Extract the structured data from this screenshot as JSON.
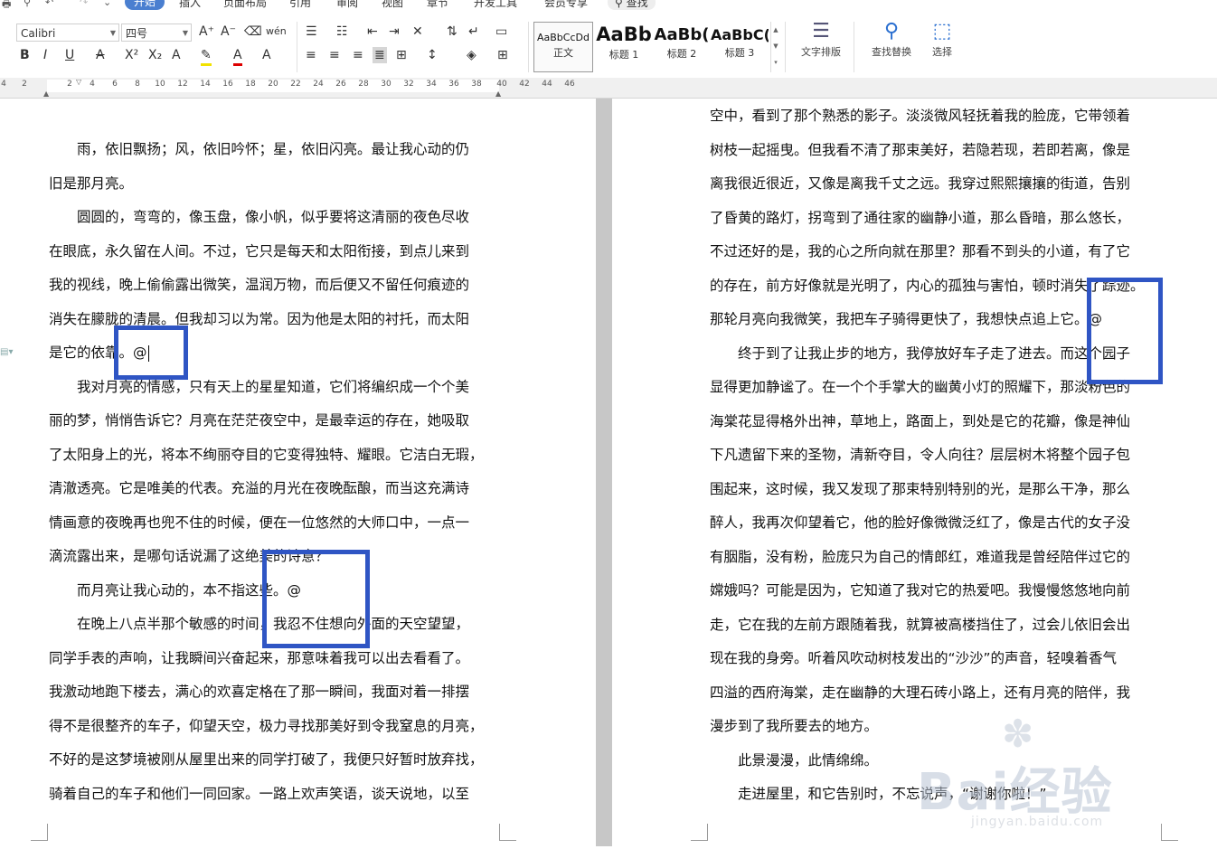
{
  "menu": {
    "tabs": [
      "开始",
      "插入",
      "页面布局",
      "引用",
      "审阅",
      "视图",
      "章节",
      "开发工具",
      "会员专享"
    ],
    "active_tab": "开始",
    "search_label": "查找"
  },
  "ribbon": {
    "font_family": "Calibri",
    "font_size": "四号",
    "styles": [
      {
        "sample": "AaBbCcDd",
        "name": "正文"
      },
      {
        "sample": "AaBb",
        "name": "标题 1"
      },
      {
        "sample": "AaBb(",
        "name": "标题 2"
      },
      {
        "sample": "AaBbC(",
        "name": "标题 3"
      }
    ],
    "text_layout_label": "文字排版",
    "find_replace_label": "查找替换",
    "select_label": "选择"
  },
  "ruler": {
    "ticks": [
      "4",
      "2",
      "2",
      "4",
      "6",
      "8",
      "10",
      "12",
      "14",
      "16",
      "18",
      "20",
      "22",
      "24",
      "26",
      "28",
      "30",
      "32",
      "34",
      "36",
      "38",
      "40",
      "42",
      "44",
      "46"
    ]
  },
  "left_page": {
    "lines": [
      "　　雨，依旧飘扬；风，依旧吟怀；星，依旧闪亮。最让我心动的仍",
      "旧是那月亮。",
      "　　圆圆的，弯弯的，像玉盘，像小帆，似乎要将这清丽的夜色尽收",
      "在眼底，永久留在人间。不过，它只是每天和太阳衔接，到点儿来到",
      "我的视线，晚上偷偷露出微笑，温润万物，而后便又不留任何痕迹的",
      "消失在朦胧的清晨。但我却习以为常。因为他是太阳的衬托，而太阳",
      "是它的依靠。@",
      "　　我对月亮的情感，只有天上的星星知道，它们将编织成一个个美",
      "丽的梦，悄悄告诉它？月亮在茫茫夜空中，是最幸运的存在，她吸取",
      "了太阳身上的光，将本不绚丽夺目的它变得独特、耀眼。它洁白无瑕，",
      "清澈透亮。它是唯美的代表。充溢的月光在夜晚酝酿，而当这充满诗",
      "情画意的夜晚再也兜不住的时候，便在一位悠然的大师口中，一点一",
      "滴流露出来，是哪句话说漏了这绝美的诗意？",
      "　　而月亮让我心动的，本不指这些。@",
      "　　在晚上八点半那个敏感的时间，我忍不住想向外面的天空望望，",
      "同学手表的声响，让我瞬间兴奋起来，那意味着我可以出去看看了。",
      "我激动地跑下楼去，满心的欢喜定格在了那一瞬间，我面对着一排摆",
      "得不是很整齐的车子，仰望天空，极力寻找那美好到令我窒息的月亮，",
      "不好的是这梦境被刚从屋里出来的同学打破了，我便只好暂时放弃找，",
      "骑着自己的车子和他们一同回家。一路上欢声笑语，谈天说地，以至"
    ]
  },
  "right_page": {
    "lines": [
      "空中，看到了那个熟悉的影子。淡淡微风轻抚着我的脸庞，它带领着",
      "树枝一起摇曳。但我看不清了那束美好，若隐若现，若即若离，像是",
      "离我很近很近，又像是离我千丈之远。我穿过熙熙攘攘的街道，告别",
      "了昏黄的路灯，拐弯到了通往家的幽静小道，那么昏暗，那么悠长，",
      "不过还好的是，我的心之所向就在那里？那看不到头的小道，有了它",
      "的存在，前方好像就是光明了，内心的孤独与害怕，顿时消失了踪迹。",
      "那轮月亮向我微笑，我把车子骑得更快了，我想快点追上它。@",
      "　　终于到了让我止步的地方，我停放好车子走了进去。而这个园子",
      "显得更加静谧了。在一个个手掌大的幽黄小灯的照耀下，那淡粉色的",
      "海棠花显得格外出神，草地上，路面上，到处是它的花瓣，像是神仙",
      "下凡遗留下来的圣物，清新夺目，令人向往？层层树木将整个园子包",
      "围起来，这时候，我又发现了那束特别特别的光，是那么干净，那么",
      "醉人，我再次仰望着它，他的脸好像微微泛红了，像是古代的女子没",
      "有胭脂，没有粉，脸庞只为自己的情郎红，难道我是曾经陪伴过它的",
      "嫦娥吗？可能是因为，它知道了我对它的热爱吧。我慢慢悠悠地向前",
      "走，它在我的左前方跟随着我，就算被高楼挡住了，过会儿依旧会出",
      "现在我的身旁。听着风吹动树枝发出的“沙沙”的声音，轻嗅着香气",
      "四溢的西府海棠，走在幽静的大理石砖小路上，还有月亮的陪伴，我",
      "漫步到了我所要去的地方。",
      "　　此景漫漫，此情绵绵。",
      "　　走进屋里，和它告别时，不忘说声，“谢谢你啦！”"
    ]
  },
  "watermark": {
    "text": "Bai经验",
    "url": "jingyan.baidu.com"
  },
  "colors": {
    "highlight_box": "#2f55c4",
    "active_tab": "#4a7fd0"
  }
}
